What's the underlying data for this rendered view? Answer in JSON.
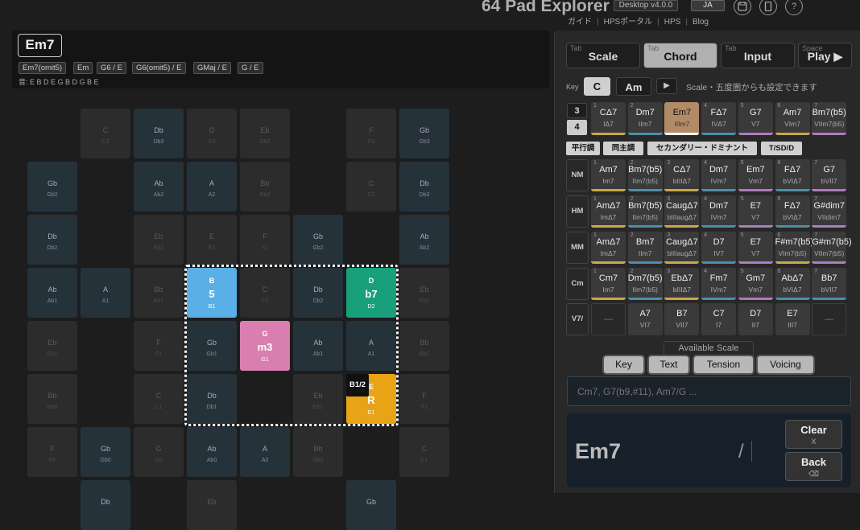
{
  "header": {
    "title": "64 Pad Explorer",
    "version": "Desktop v4.0.0",
    "language": "JA",
    "links": [
      "ガイド",
      "HPSポータル",
      "HPS",
      "Blog"
    ],
    "icons": [
      "save-icon",
      "tablet-icon",
      "help-icon"
    ],
    "help_glyph": "?"
  },
  "chord_panel": {
    "current": "Em7",
    "alternates": [
      "Em7(omit5)",
      "Em",
      "G6 / E",
      "G6(omit5) / E",
      "GMaj / E",
      "G / E"
    ],
    "tones": "音: E B D E G B D G B E"
  },
  "pads": [
    [
      null,
      [
        "C",
        "C3",
        "g"
      ],
      [
        "Db",
        "Db3",
        "b"
      ],
      [
        "D",
        "D3",
        "g"
      ],
      [
        "Eb",
        "Eb3",
        "g"
      ],
      null,
      [
        "F",
        "F3",
        "g"
      ],
      [
        "Gb",
        "Gb3",
        "b"
      ]
    ],
    [
      [
        "Gb",
        "Gb2",
        "b"
      ],
      null,
      [
        "Ab",
        "Ab2",
        "b"
      ],
      [
        "A",
        "A2",
        "b"
      ],
      [
        "Bb",
        "Bb2",
        "g"
      ],
      null,
      [
        "C",
        "C3",
        "g"
      ],
      [
        "Db",
        "Db3",
        "b"
      ]
    ],
    [
      [
        "Db",
        "Db2",
        "b"
      ],
      null,
      [
        "Eb",
        "Eb2",
        "g"
      ],
      [
        "E",
        "E2",
        "g"
      ],
      [
        "F",
        "F2",
        "g"
      ],
      [
        "Gb",
        "Gb2",
        "b"
      ],
      null,
      [
        "Ab",
        "Ab2",
        "b"
      ]
    ],
    [
      [
        "Ab",
        "Ab1",
        "b"
      ],
      [
        "A",
        "A1",
        "b"
      ],
      [
        "Bb",
        "Bb1",
        "g"
      ],
      [
        "B",
        "B1",
        "act",
        "#5ab0e6",
        "5"
      ],
      [
        "C",
        "C2",
        "g"
      ],
      [
        "Db",
        "Db2",
        "b"
      ],
      [
        "D",
        "D2",
        "act",
        "#17a07a",
        "b7"
      ],
      [
        "Eb",
        "Eb2",
        "g"
      ]
    ],
    [
      [
        "Eb",
        "Eb1",
        "g"
      ],
      null,
      [
        "F",
        "F1",
        "g"
      ],
      [
        "Gb",
        "Gb1",
        "b"
      ],
      [
        "G",
        "G1",
        "act",
        "#d87fb0",
        "m3"
      ],
      [
        "Ab",
        "Ab1",
        "b"
      ],
      [
        "A",
        "A1",
        "b"
      ],
      [
        "Bb",
        "Bb1",
        "g"
      ]
    ],
    [
      [
        "Bb",
        "Bb0",
        "g"
      ],
      null,
      [
        "C",
        "C1",
        "g"
      ],
      [
        "Db",
        "Db1",
        "b"
      ],
      null,
      [
        "Eb",
        "Eb1",
        "g"
      ],
      [
        "E",
        "E1",
        "act",
        "#e8a317",
        "R"
      ],
      [
        "F",
        "F1",
        "g"
      ]
    ],
    [
      [
        "F",
        "F0",
        "g"
      ],
      [
        "Gb",
        "Gb0",
        "b"
      ],
      [
        "G",
        "G0",
        "g"
      ],
      [
        "Ab",
        "Ab0",
        "b"
      ],
      [
        "A",
        "A0",
        "b"
      ],
      [
        "Bb",
        "Bb0",
        "g"
      ],
      null,
      [
        "C",
        "C1",
        "g"
      ]
    ],
    [
      null,
      [
        "Db",
        "",
        "b"
      ],
      null,
      [
        "Eb",
        "",
        "g"
      ],
      null,
      null,
      [
        "Gb",
        "",
        "b"
      ],
      null
    ]
  ],
  "bass_badge": "B1/2",
  "mode_tabs": [
    {
      "key": "Tab",
      "label": "Scale"
    },
    {
      "key": "Tab",
      "label": "Chord"
    },
    {
      "key": "Tab",
      "label": "Input"
    },
    {
      "key": "Space",
      "label": "Play ▶"
    }
  ],
  "active_mode": "Chord",
  "key_row": {
    "label": "Key",
    "major": "C",
    "minor": "Am",
    "play": "▶",
    "note": "Scale・五度圏からも設定できます"
  },
  "tones_toggle": [
    "3",
    "4"
  ],
  "diatonic": [
    {
      "n": "1",
      "a": "CΔ7",
      "b": "IΔ7",
      "c": "#c9a84a"
    },
    {
      "n": "2",
      "a": "Dm7",
      "b": "IIm7",
      "c": "#4a8faa"
    },
    {
      "n": "3",
      "a": "Em7",
      "b": "IIIm7",
      "c": "#ffffff",
      "hl": true
    },
    {
      "n": "4",
      "a": "FΔ7",
      "b": "IVΔ7",
      "c": "#4a8faa"
    },
    {
      "n": "5",
      "a": "G7",
      "b": "V7",
      "c": "#b07ac0"
    },
    {
      "n": "6",
      "a": "Am7",
      "b": "VIm7",
      "c": "#c9a84a"
    },
    {
      "n": "7",
      "a": "Bm7(b5)",
      "b": "VIIm7(b5)",
      "c": "#b07ac0"
    }
  ],
  "function_buttons": [
    "平行調",
    "同主調",
    "セカンダリー・ドミナント",
    "T/SD/D"
  ],
  "rows": [
    {
      "label": "NM",
      "cells": [
        {
          "n": "1",
          "a": "Am7",
          "b": "Im7",
          "c": "#c9a84a"
        },
        {
          "n": "2",
          "a": "Bm7(b5)",
          "b": "IIm7(b5)",
          "c": "#4a8faa"
        },
        {
          "n": "3",
          "a": "CΔ7",
          "b": "bIIIΔ7",
          "c": "#c9a84a"
        },
        {
          "n": "4",
          "a": "Dm7",
          "b": "IVm7",
          "c": "#4a8faa"
        },
        {
          "n": "5",
          "a": "Em7",
          "b": "Vm7",
          "c": "#b07ac0"
        },
        {
          "n": "6",
          "a": "FΔ7",
          "b": "bVIΔ7",
          "c": "#4a8faa"
        },
        {
          "n": "7",
          "a": "G7",
          "b": "bVII7",
          "c": "#b07ac0"
        }
      ]
    },
    {
      "label": "HM",
      "cells": [
        {
          "n": "1",
          "a": "AmΔ7",
          "b": "ImΔ7",
          "c": "#c9a84a"
        },
        {
          "n": "2",
          "a": "Bm7(b5)",
          "b": "IIm7(b5)",
          "c": "#4a8faa"
        },
        {
          "n": "3",
          "a": "CaugΔ7",
          "b": "bIIIaugΔ7",
          "c": "#c9a84a"
        },
        {
          "n": "4",
          "a": "Dm7",
          "b": "IVm7",
          "c": "#4a8faa"
        },
        {
          "n": "5",
          "a": "E7",
          "b": "V7",
          "c": "#b07ac0"
        },
        {
          "n": "6",
          "a": "FΔ7",
          "b": "bVIΔ7",
          "c": "#4a8faa"
        },
        {
          "n": "7",
          "a": "G#dim7",
          "b": "VIIdim7",
          "c": "#b07ac0"
        }
      ]
    },
    {
      "label": "MM",
      "cells": [
        {
          "n": "1",
          "a": "AmΔ7",
          "b": "ImΔ7",
          "c": "#c9a84a"
        },
        {
          "n": "2",
          "a": "Bm7",
          "b": "IIm7",
          "c": "#4a8faa"
        },
        {
          "n": "3",
          "a": "CaugΔ7",
          "b": "bIIIaugΔ7",
          "c": "#c9a84a"
        },
        {
          "n": "4",
          "a": "D7",
          "b": "IV7",
          "c": "#4a8faa"
        },
        {
          "n": "5",
          "a": "E7",
          "b": "V7",
          "c": "#b07ac0"
        },
        {
          "n": "6",
          "a": "F#m7(b5)",
          "b": "VIm7(b5)",
          "c": "#c9a84a"
        },
        {
          "n": "7",
          "a": "G#m7(b5)",
          "b": "VIIm7(b5)",
          "c": "#b07ac0"
        }
      ]
    },
    {
      "label": "Cm",
      "cells": [
        {
          "n": "1",
          "a": "Cm7",
          "b": "Im7",
          "c": "#c9a84a"
        },
        {
          "n": "2",
          "a": "Dm7(b5)",
          "b": "IIm7(b5)",
          "c": "#4a8faa"
        },
        {
          "n": "3",
          "a": "EbΔ7",
          "b": "bIIIΔ7",
          "c": "#c9a84a"
        },
        {
          "n": "4",
          "a": "Fm7",
          "b": "IVm7",
          "c": "#4a8faa"
        },
        {
          "n": "5",
          "a": "Gm7",
          "b": "Vm7",
          "c": "#b07ac0"
        },
        {
          "n": "6",
          "a": "AbΔ7",
          "b": "bVIΔ7",
          "c": "#4a8faa"
        },
        {
          "n": "7",
          "a": "Bb7",
          "b": "bVII7",
          "c": "#4a8faa"
        }
      ]
    },
    {
      "label": "V7/",
      "cells": [
        {
          "empty": true,
          "a": "—"
        },
        {
          "a": "A7",
          "b": "VI7"
        },
        {
          "a": "B7",
          "b": "VII7"
        },
        {
          "a": "C7",
          "b": "I7"
        },
        {
          "a": "D7",
          "b": "II7"
        },
        {
          "a": "E7",
          "b": "III7"
        },
        {
          "empty": true,
          "a": "—"
        }
      ]
    }
  ],
  "available_scale": "Available Scale",
  "view_tabs": [
    "Key",
    "Text",
    "Tension",
    "Voicing"
  ],
  "chord_input_placeholder": "Cm7, G7(b9,#11), Am7/G ...",
  "display": {
    "chord": "Em7",
    "slash": "/"
  },
  "controls": {
    "clear": "Clear",
    "clear_key": "X",
    "back": "Back",
    "back_key": "⌫"
  }
}
